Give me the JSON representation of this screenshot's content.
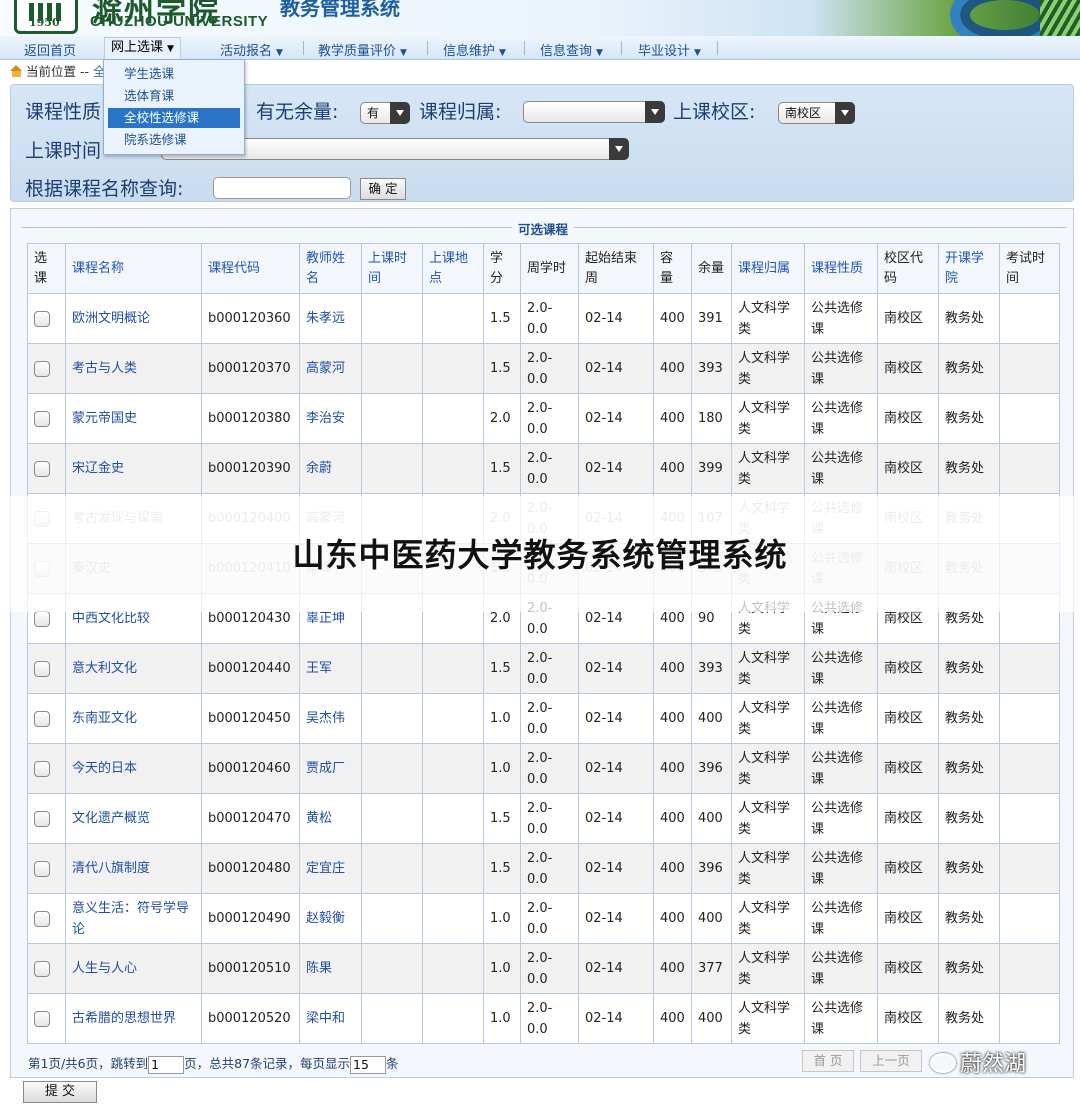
{
  "header": {
    "logo_year": "1950",
    "university_en": "CHUZHOU UNIVERSITY",
    "university_cn": "滁州学院",
    "system_title": "教务管理系统"
  },
  "nav": {
    "items": [
      {
        "label": "返回首页",
        "caret": false
      },
      {
        "label": "网上选课",
        "caret": true
      },
      {
        "label": "活动报名",
        "caret": true
      },
      {
        "label": "教学质量评价",
        "caret": true
      },
      {
        "label": "信息维护",
        "caret": true
      },
      {
        "label": "信息查询",
        "caret": true
      },
      {
        "label": "毕业设计",
        "caret": true
      }
    ],
    "caret_glyph": "▼"
  },
  "breadcrumb": {
    "prefix": "当前位置 --",
    "tail": "全"
  },
  "dropdown": {
    "items": [
      "学生选课",
      "选体育课",
      "全校性选修课",
      "院系选修课"
    ],
    "selected_index": 2
  },
  "filters": {
    "course_nature_label": "课程性质",
    "remaining_label": "有无余量:",
    "remaining_value": "有",
    "belong_label": "课程归属:",
    "belong_value": "",
    "campus_label": "上课校区:",
    "campus_value": "南校区",
    "time_label": "上课时间",
    "time_value": "",
    "name_query_label": "根据课程名称查询:",
    "name_query_value": "",
    "confirm_label": "确 定"
  },
  "table": {
    "caption": "可选课程",
    "headers": [
      "选课",
      "课程名称",
      "课程代码",
      "教师姓名",
      "上课时间",
      "上课地点",
      "学分",
      "周学时",
      "起始结束周",
      "容量",
      "余量",
      "课程归属",
      "课程性质",
      "校区代码",
      "开课学院",
      "考试时间"
    ],
    "rows": [
      {
        "name": "欧洲文明概论",
        "code": "b000120360",
        "teacher": "朱孝远",
        "credit": "1.5",
        "hours": "2.0-0.0",
        "weeks": "02-14",
        "capacity": "400",
        "remain": "391",
        "belong": "人文科学类",
        "nature": "公共选修课",
        "campus": "南校区",
        "college": "教务处"
      },
      {
        "name": "考古与人类",
        "code": "b000120370",
        "teacher": "高蒙河",
        "credit": "1.5",
        "hours": "2.0-0.0",
        "weeks": "02-14",
        "capacity": "400",
        "remain": "393",
        "belong": "人文科学类",
        "nature": "公共选修课",
        "campus": "南校区",
        "college": "教务处"
      },
      {
        "name": "蒙元帝国史",
        "code": "b000120380",
        "teacher": "李治安",
        "credit": "2.0",
        "hours": "2.0-0.0",
        "weeks": "02-14",
        "capacity": "400",
        "remain": "180",
        "belong": "人文科学类",
        "nature": "公共选修课",
        "campus": "南校区",
        "college": "教务处"
      },
      {
        "name": "宋辽金史",
        "code": "b000120390",
        "teacher": "余蔚",
        "credit": "1.5",
        "hours": "2.0-0.0",
        "weeks": "02-14",
        "capacity": "400",
        "remain": "399",
        "belong": "人文科学类",
        "nature": "公共选修课",
        "campus": "南校区",
        "college": "教务处"
      },
      {
        "name": "考古发现与探索",
        "code": "b000120400",
        "teacher": "高蒙河",
        "credit": "2.0",
        "hours": "2.0-0.0",
        "weeks": "02-14",
        "capacity": "400",
        "remain": "107",
        "belong": "人文科学类",
        "nature": "公共选修课",
        "campus": "南校区",
        "college": "教务处"
      },
      {
        "name": "秦汉史",
        "code": "b000120410",
        "teacher": "秦晖",
        "credit": "1.5",
        "hours": "2.0-0.0",
        "weeks": "02-14",
        "capacity": "400",
        "remain": "378",
        "belong": "人文科学类",
        "nature": "公共选修课",
        "campus": "南校区",
        "college": "教务处"
      },
      {
        "name": "中西文化比较",
        "code": "b000120430",
        "teacher": "辜正坤",
        "credit": "2.0",
        "hours": "2.0-0.0",
        "weeks": "02-14",
        "capacity": "400",
        "remain": "90",
        "belong": "人文科学类",
        "nature": "公共选修课",
        "campus": "南校区",
        "college": "教务处"
      },
      {
        "name": "意大利文化",
        "code": "b000120440",
        "teacher": "王军",
        "credit": "1.5",
        "hours": "2.0-0.0",
        "weeks": "02-14",
        "capacity": "400",
        "remain": "393",
        "belong": "人文科学类",
        "nature": "公共选修课",
        "campus": "南校区",
        "college": "教务处"
      },
      {
        "name": "东南亚文化",
        "code": "b000120450",
        "teacher": "吴杰伟",
        "credit": "1.0",
        "hours": "2.0-0.0",
        "weeks": "02-14",
        "capacity": "400",
        "remain": "400",
        "belong": "人文科学类",
        "nature": "公共选修课",
        "campus": "南校区",
        "college": "教务处"
      },
      {
        "name": "今天的日本",
        "code": "b000120460",
        "teacher": "贾成厂",
        "credit": "1.0",
        "hours": "2.0-0.0",
        "weeks": "02-14",
        "capacity": "400",
        "remain": "396",
        "belong": "人文科学类",
        "nature": "公共选修课",
        "campus": "南校区",
        "college": "教务处"
      },
      {
        "name": "文化遗产概览",
        "code": "b000120470",
        "teacher": "黄松",
        "credit": "1.5",
        "hours": "2.0-0.0",
        "weeks": "02-14",
        "capacity": "400",
        "remain": "400",
        "belong": "人文科学类",
        "nature": "公共选修课",
        "campus": "南校区",
        "college": "教务处"
      },
      {
        "name": "清代八旗制度",
        "code": "b000120480",
        "teacher": "定宜庄",
        "credit": "1.5",
        "hours": "2.0-0.0",
        "weeks": "02-14",
        "capacity": "400",
        "remain": "396",
        "belong": "人文科学类",
        "nature": "公共选修课",
        "campus": "南校区",
        "college": "教务处"
      },
      {
        "name": "意义生活：符号学导论",
        "code": "b000120490",
        "teacher": "赵毅衡",
        "credit": "1.0",
        "hours": "2.0-0.0",
        "weeks": "02-14",
        "capacity": "400",
        "remain": "400",
        "belong": "人文科学类",
        "nature": "公共选修课",
        "campus": "南校区",
        "college": "教务处"
      },
      {
        "name": "人生与人心",
        "code": "b000120510",
        "teacher": "陈果",
        "credit": "1.0",
        "hours": "2.0-0.0",
        "weeks": "02-14",
        "capacity": "400",
        "remain": "377",
        "belong": "人文科学类",
        "nature": "公共选修课",
        "campus": "南校区",
        "college": "教务处"
      },
      {
        "name": "古希腊的思想世界",
        "code": "b000120520",
        "teacher": "梁中和",
        "credit": "1.0",
        "hours": "2.0-0.0",
        "weeks": "02-14",
        "capacity": "400",
        "remain": "400",
        "belong": "人文科学类",
        "nature": "公共选修课",
        "campus": "南校区",
        "college": "教务处"
      }
    ]
  },
  "pager": {
    "text_before": "第1页/共6页，跳转到",
    "page_value": "1",
    "text_middle": "页，总共87条记录，每页显示",
    "per_page_value": "15",
    "text_after": "条",
    "first_label": "首 页",
    "prev_label": "上一页"
  },
  "submit_label": "提 交",
  "watermark": {
    "center_text": "山东中医药大学教务系统管理系统",
    "corner_text": "蔚然湖"
  }
}
